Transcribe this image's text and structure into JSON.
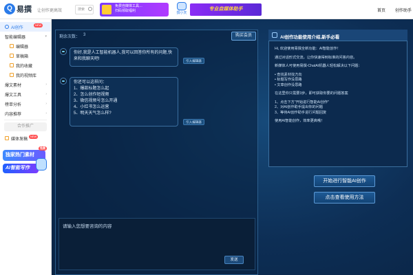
{
  "header": {
    "logo_mark": "Q",
    "logo_text": "易撰",
    "slogan": "让创作更高效",
    "search_placeholder": "搜索",
    "banner1_lines": [
      "免费自媒体工具…",
      "扫码领取福利"
    ],
    "mascot_label": "撰小天",
    "banner2_text": "专业自媒体助手",
    "nav_home": "首页",
    "nav_assistant": "创作助手"
  },
  "sidebar": {
    "items": [
      {
        "label": "AI创作",
        "active": true,
        "badge": "NEW"
      },
      {
        "label": "智能编辑器",
        "chevron": "▾"
      },
      {
        "label": "编辑器",
        "sub": true
      },
      {
        "label": "草稿箱",
        "sub": true
      },
      {
        "label": "我的收藏",
        "sub": true
      },
      {
        "label": "我的视频库",
        "sub": true
      },
      {
        "label": "爆文素材",
        "chevron": "›"
      },
      {
        "label": "爆文工具",
        "chevron": "›"
      },
      {
        "label": "榜单分析",
        "chevron": "›"
      },
      {
        "label": "内容推荐",
        "chevron": "›"
      }
    ],
    "promo_label": "合作推广",
    "media_publish": {
      "label": "媒体发稿",
      "badge": "NEW"
    },
    "ad1": {
      "label": "独家热门素材",
      "badge": "免费"
    },
    "ad2": {
      "label": "AI智能写作"
    }
  },
  "chat": {
    "remaining_label": "剩余次数：",
    "remaining_value": "3",
    "buy_label": "购买会员",
    "messages": [
      {
        "lines": [
          "你好,我是人工智能机器人,我可以回答你所有的问题,快",
          "来和我聊天吧!"
        ]
      },
      {
        "lines": [
          "你还可以这样问：",
          "1、爆款标题怎么起",
          "2、怎么创作短视频",
          "3、微信视频号怎么开通",
          "4、小红书怎么运营",
          "5、明天天气怎么样?"
        ]
      }
    ],
    "quote_label": "引入编辑器",
    "input_placeholder": "请输入您想要咨询的内容",
    "send_label": "发送"
  },
  "intro": {
    "title": "AI创作功能使用介绍,新手必看",
    "paragraphs": [
      [
        "Hi, 欢迎使用易撰全新功能：AI智能创作！"
      ],
      [
        "通过对话形式交流，让你快速得到标准的问答内容。"
      ],
      [
        "新媒体人可使用易撰-ChatAI机器人轻松解决以下问题："
      ],
      [
        "• 查找素材找方向",
        "• 标题写作没思路",
        "• 文章创作没思路"
      ],
      [
        "在这里你只需要3步，即可获取你要的问题答案"
      ],
      [
        "1、点击下方\"开始进行智能AI创作\"",
        "2、对AI创作助手提出你的问题",
        "3、等待AI创作助手进行问题回复"
      ],
      [
        "使用AI智能创作，效率更高哦！"
      ]
    ],
    "start_btn": "开始进行智能AI创作",
    "howto_btn": "点击查看使用方法"
  }
}
